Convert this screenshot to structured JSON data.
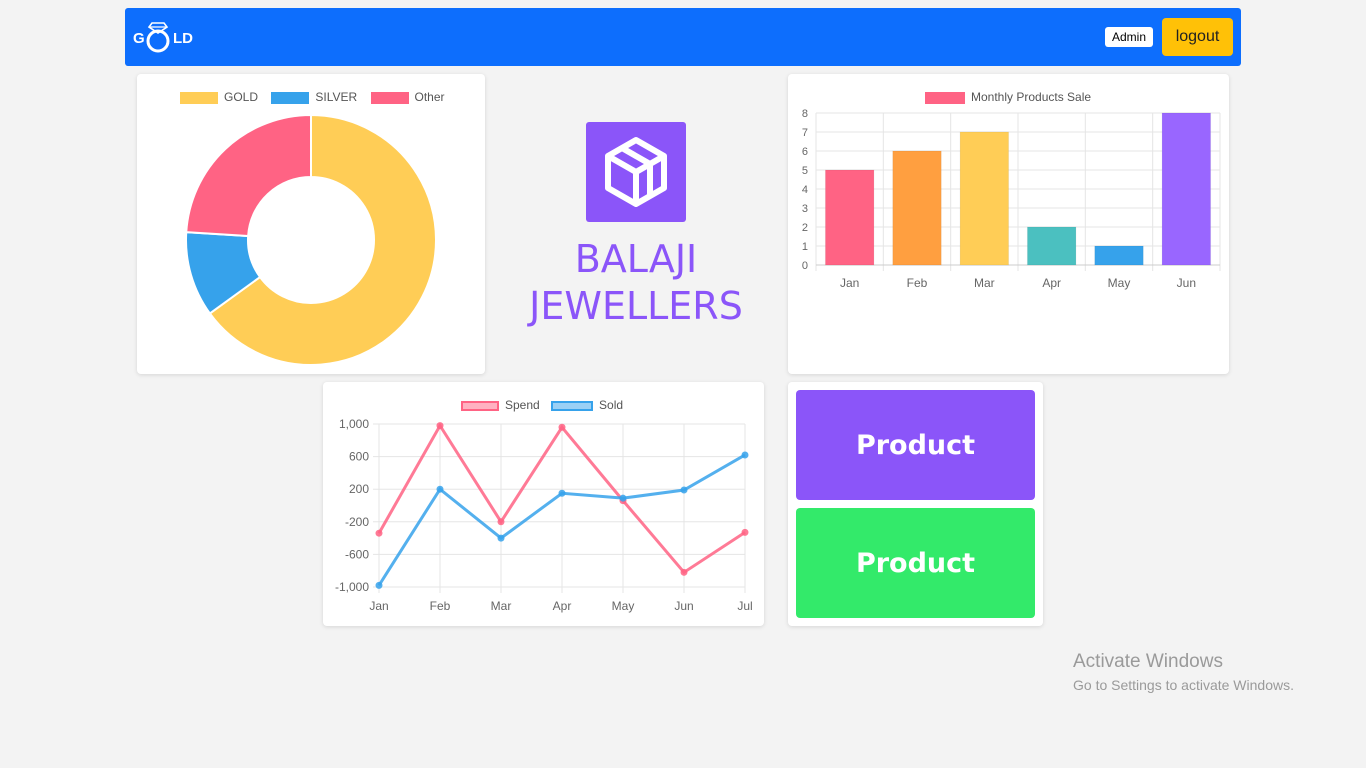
{
  "navbar": {
    "logo_left": "G",
    "logo_right": "LD",
    "admin_label": "Admin",
    "logout_label": "logout",
    "bg_color": "#0d6efd"
  },
  "brand": {
    "line1": "BALAJI",
    "line2": "JEWELLERS",
    "icon": "cube-icon",
    "color": "#8b55f9"
  },
  "products": [
    {
      "label": "Product",
      "color": "#8b55f9"
    },
    {
      "label": "Product",
      "color": "#33ea6a"
    }
  ],
  "watermark": {
    "title": "Activate Windows",
    "subtitle": "Go to Settings to activate Windows."
  },
  "chart_data": [
    {
      "type": "pie",
      "variant": "doughnut",
      "categories": [
        "GOLD",
        "SILVER",
        "Other"
      ],
      "values": [
        65,
        11,
        24
      ],
      "colors": [
        "#ffcd56",
        "#36a2eb",
        "#ff6384"
      ],
      "legend": "top"
    },
    {
      "type": "bar",
      "categories": [
        "Jan",
        "Feb",
        "Mar",
        "Apr",
        "May",
        "Jun"
      ],
      "series": [
        {
          "name": "Monthly Products Sale",
          "values": [
            5,
            6,
            7,
            2,
            1,
            8
          ]
        }
      ],
      "colors": [
        "#ff6384",
        "#ff9f40",
        "#ffcd56",
        "#4bc0c0",
        "#36a2eb",
        "#9966ff"
      ],
      "ylim": [
        0,
        8
      ],
      "yticks": [
        0,
        1,
        2,
        3,
        4,
        5,
        6,
        7,
        8
      ],
      "grid": true,
      "legend": "top"
    },
    {
      "type": "line",
      "categories": [
        "Jan",
        "Feb",
        "Mar",
        "Apr",
        "May",
        "Jun",
        "Jul"
      ],
      "series": [
        {
          "name": "Spend",
          "values": [
            -340,
            980,
            -200,
            960,
            60,
            -820,
            -330
          ],
          "color": "#ff6384"
        },
        {
          "name": "Sold",
          "values": [
            -980,
            200,
            -400,
            150,
            90,
            190,
            620
          ],
          "color": "#36a2eb"
        }
      ],
      "ylim": [
        -1000,
        1000
      ],
      "yticks": [
        "1,000",
        "600",
        "200",
        "-200",
        "-600",
        "-1,000"
      ],
      "grid": true,
      "legend": "top"
    }
  ]
}
